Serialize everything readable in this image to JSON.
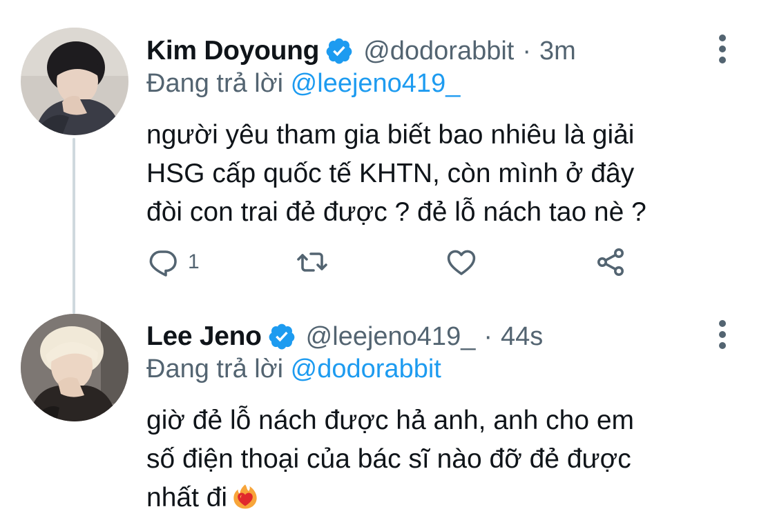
{
  "tweets": [
    {
      "name": "Kim Doyoung",
      "handle": "@dodorabbit",
      "separator": "·",
      "time": "3m",
      "replying_prefix": "Đang trả lời",
      "replying_to": "@leejeno419_",
      "text_lines": [
        "người yêu tham gia biết bao nhiêu là giải",
        "HSG cấp quốc tế KHTN, còn mình ở đây",
        "đòi con trai đẻ được ? đẻ lỗ nách tao nè ?"
      ],
      "reply_count": "1",
      "icons": {
        "reply": "reply-icon",
        "retweet": "retweet-icon",
        "like": "heart-icon",
        "share": "share-icon",
        "verified": "verified-badge-icon",
        "more": "more-vertical-icon"
      }
    },
    {
      "name": "Lee Jeno",
      "handle": "@leejeno419_",
      "separator": "·",
      "time": "44s",
      "replying_prefix": "Đang trả lời",
      "replying_to": "@dodorabbit",
      "text_lines": [
        "giờ đẻ lỗ nách được hả anh, anh cho em",
        "số điện thoại của bác sĩ nào đỡ đẻ được",
        "nhất đi"
      ],
      "emoji": "heart-on-fire-emoji"
    }
  ],
  "colors": {
    "text": "#0f1419",
    "secondary": "#536471",
    "link": "#1d9bf0",
    "verified": "#1d9bf0",
    "thread_line": "#cfd9de"
  }
}
